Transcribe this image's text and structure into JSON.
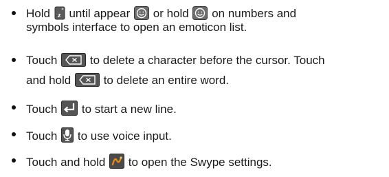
{
  "bullets": [
    {
      "line1": [
        "Hold",
        "until appear",
        "or hold",
        "on numbers and"
      ],
      "line2": "symbols interface to open an emoticon list."
    },
    {
      "line1": [
        "Touch",
        "to delete a character before the cursor. Touch"
      ],
      "line2": [
        "and hold",
        "to delete an entire word."
      ]
    },
    {
      "line1": [
        "Touch",
        "to start a new line."
      ]
    },
    {
      "line1": [
        "Touch",
        "to use voice input."
      ]
    },
    {
      "line1": [
        "Touch and hold",
        "to open the Swype settings."
      ]
    }
  ],
  "icons": {
    "z_key": "z-key-icon",
    "emoticon": "emoticon-icon",
    "backspace": "backspace-icon",
    "enter": "enter-icon",
    "microphone": "microphone-icon",
    "swype": "swype-settings-icon"
  },
  "colors": {
    "text": "#1a1a1a",
    "icon_grey": "#5a5a5a",
    "swype_accent": "#e08a1a"
  }
}
